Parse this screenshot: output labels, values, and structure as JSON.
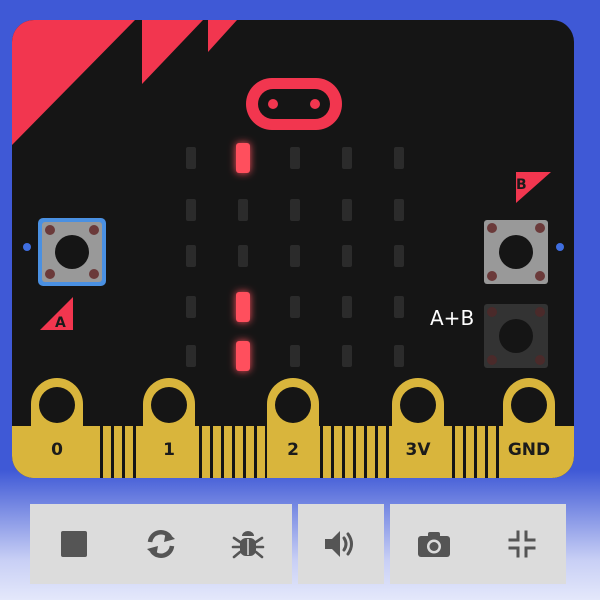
{
  "board": {
    "button_a_label": "A",
    "button_b_label": "B",
    "button_ab_label": "A+B",
    "pins": [
      "0",
      "1",
      "2",
      "3V",
      "GND"
    ],
    "led_matrix": [
      [
        0,
        1,
        0,
        0,
        0
      ],
      [
        0,
        0,
        0,
        0,
        0
      ],
      [
        0,
        0,
        0,
        0,
        0
      ],
      [
        0,
        1,
        0,
        0,
        0
      ],
      [
        0,
        1,
        0,
        0,
        0
      ]
    ],
    "colors": {
      "board": "#151515",
      "accent": "#f2364f",
      "gold": "#d9b53c",
      "led_on": "#ff4f5d",
      "led_off": "#2b2b2b"
    }
  },
  "toolbar": {
    "buttons": [
      {
        "name": "stop",
        "icon": "stop-icon"
      },
      {
        "name": "restart",
        "icon": "restart-icon"
      },
      {
        "name": "debug",
        "icon": "bug-icon"
      },
      {
        "name": "sound",
        "icon": "volume-icon"
      },
      {
        "name": "screenshot",
        "icon": "camera-icon"
      },
      {
        "name": "fullscreen",
        "icon": "collapse-icon"
      }
    ]
  }
}
